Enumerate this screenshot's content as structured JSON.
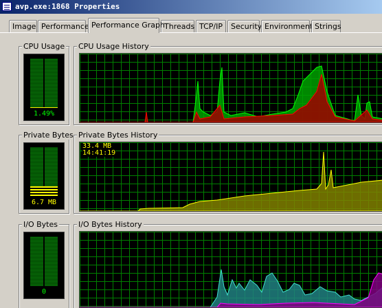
{
  "window": {
    "title": "avp.exe:1868 Properties",
    "icon": "process-icon"
  },
  "tabs": [
    {
      "label": "Image",
      "active": false
    },
    {
      "label": "Performance",
      "active": false
    },
    {
      "label": "Performance Graph",
      "active": true
    },
    {
      "label": "Threads",
      "active": false
    },
    {
      "label": "TCP/IP",
      "active": false
    },
    {
      "label": "Security",
      "active": false
    },
    {
      "label": "Environment",
      "active": false
    },
    {
      "label": "Strings",
      "active": false
    }
  ],
  "cpu": {
    "meter_label": "CPU Usage",
    "meter_value": "1.49%",
    "meter_fraction": 0.015,
    "history_label": "CPU Usage History",
    "colors": {
      "total": "#00ff00",
      "kernel": "#ff0000"
    }
  },
  "private_bytes": {
    "meter_label": "Private Bytes",
    "meter_value": "6.7 MB",
    "meter_fraction": 0.2,
    "history_label": "Private Bytes History",
    "tooltip_value": "33.4 MB",
    "tooltip_time": "14:41:19",
    "color": "#ffff00"
  },
  "io_bytes": {
    "meter_label": "I/O Bytes",
    "meter_value": "0",
    "meter_fraction": 0,
    "history_label": "I/O Bytes History",
    "colors": {
      "read_write": "#40e0d0",
      "other": "#ff00ff"
    }
  },
  "colors": {
    "grid": "#008000",
    "graph_bg": "#000000",
    "meter_text": "#00ff00",
    "titlebar": "#0a246a"
  }
}
